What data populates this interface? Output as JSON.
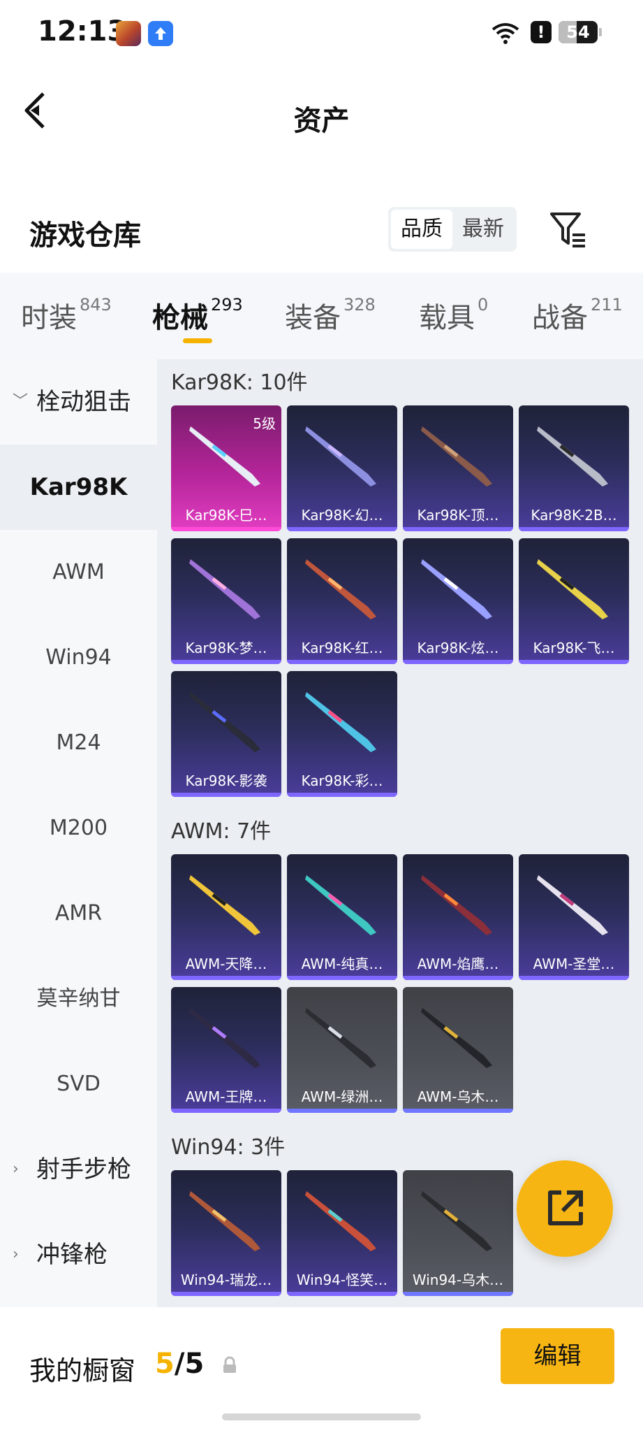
{
  "status_bar": {
    "time": "12:13",
    "battery": "54",
    "battery_level": 0.54,
    "alert_icon": "!"
  },
  "header": {
    "title": "资产"
  },
  "warehouse": {
    "title": "游戏仓库",
    "sort": {
      "options": [
        "品质",
        "最新"
      ],
      "selected": "品质"
    }
  },
  "tabs": [
    {
      "label": "时装",
      "count": "843"
    },
    {
      "label": "枪械",
      "count": "293",
      "active": true
    },
    {
      "label": "装备",
      "count": "328"
    },
    {
      "label": "载具",
      "count": "0"
    },
    {
      "label": "战备",
      "count": "211"
    }
  ],
  "sidenav": {
    "group_sniper": "栓动狙击",
    "items": [
      "Kar98K",
      "AWM",
      "Win94",
      "M24",
      "M200",
      "AMR",
      "莫辛纳甘",
      "SVD"
    ],
    "active_item": "Kar98K",
    "group_marksman": "射手步枪",
    "group_smg": "冲锋枪"
  },
  "sections": [
    {
      "title": "Kar98K: 10件",
      "items": [
        {
          "name": "Kar98K-巳…",
          "level": "5级",
          "tier": "pink"
        },
        {
          "name": "Kar98K-幻…",
          "tier": "purple"
        },
        {
          "name": "Kar98K-顶…",
          "tier": "purple"
        },
        {
          "name": "Kar98K-2B…",
          "tier": "purple"
        },
        {
          "name": "Kar98K-梦…",
          "tier": "purple"
        },
        {
          "name": "Kar98K-红…",
          "tier": "purple"
        },
        {
          "name": "Kar98K-炫…",
          "tier": "purple"
        },
        {
          "name": "Kar98K-飞…",
          "tier": "purple"
        },
        {
          "name": "Kar98K-影袭",
          "tier": "purple"
        },
        {
          "name": "Kar98K-彩…",
          "tier": "purple"
        }
      ]
    },
    {
      "title": "AWM: 7件",
      "items": [
        {
          "name": "AWM-天降…",
          "tier": "purple"
        },
        {
          "name": "AWM-纯真…",
          "tier": "purple"
        },
        {
          "name": "AWM-焰鹰…",
          "tier": "purple"
        },
        {
          "name": "AWM-圣堂…",
          "tier": "purple"
        },
        {
          "name": "AWM-王牌…",
          "tier": "purple"
        },
        {
          "name": "AWM-绿洲…",
          "tier": "gray"
        },
        {
          "name": "AWM-乌木…",
          "tier": "gray"
        }
      ]
    },
    {
      "title": "Win94: 3件",
      "items": [
        {
          "name": "Win94-瑞龙…",
          "tier": "purple"
        },
        {
          "name": "Win94-怪笑…",
          "tier": "purple"
        },
        {
          "name": "Win94-乌木…",
          "tier": "gray"
        }
      ]
    }
  ],
  "showcase": {
    "label": "我的橱窗",
    "current": "5",
    "slash": "/",
    "total": "5",
    "edit_label": "编辑"
  },
  "colors": {
    "accent": "#f7b514",
    "card_purple": "#4a3d9c",
    "card_pink": "#e23ec2",
    "card_gray": "#5a5d65"
  }
}
